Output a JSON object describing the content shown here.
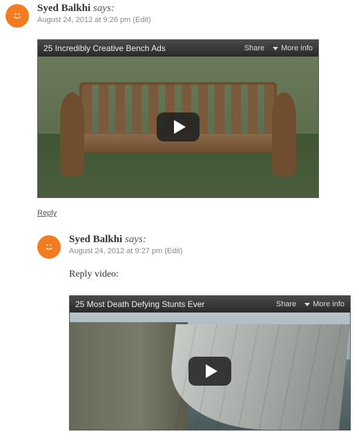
{
  "comments": [
    {
      "author": "Syed Balkhi",
      "says": "says:",
      "date": "August 24, 2012 at 9:26 pm",
      "edit": "(Edit)",
      "video": {
        "title": "25 Incredibly Creative Bench Ads",
        "share": "Share",
        "more": "More info"
      },
      "reply": "Reply"
    },
    {
      "author": "Syed Balkhi",
      "says": "says:",
      "date": "August 24, 2012 at 9:27 pm",
      "edit": "(Edit)",
      "content": "Reply video:",
      "video": {
        "title": "25 Most Death Defying Stunts Ever",
        "share": "Share",
        "more": "More info"
      }
    }
  ]
}
